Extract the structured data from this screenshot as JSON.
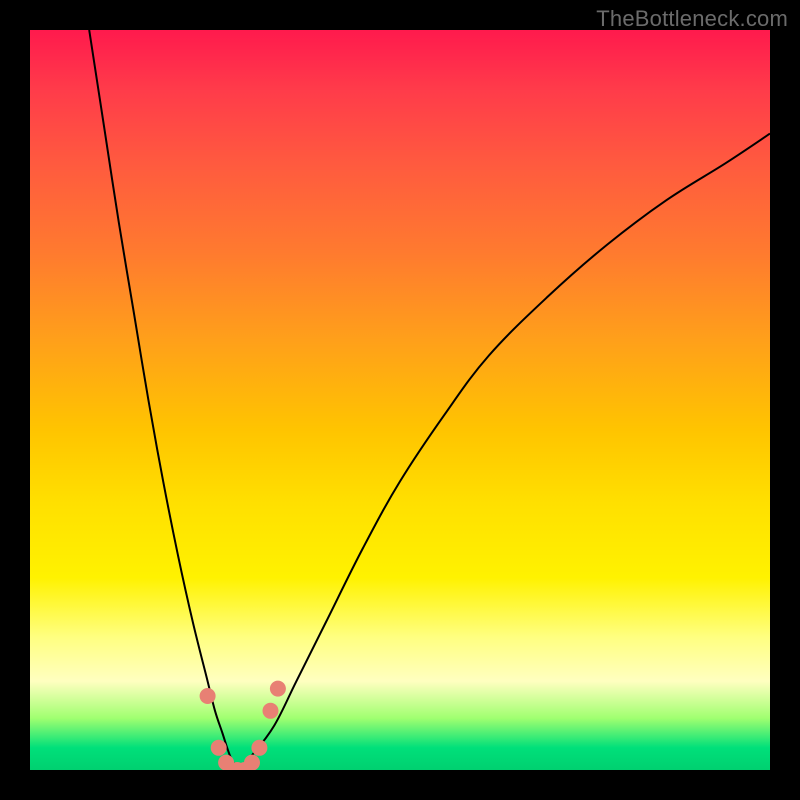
{
  "watermark": "TheBottleneck.com",
  "chart_data": {
    "type": "line",
    "title": "",
    "xlabel": "",
    "ylabel": "",
    "xlim": [
      0,
      100
    ],
    "ylim": [
      0,
      100
    ],
    "background_gradient": {
      "top_color": "#ff1a4d",
      "mid_color": "#ffe000",
      "bottom_color": "#00d070"
    },
    "series": [
      {
        "name": "left-curve",
        "x": [
          8,
          10,
          12,
          14,
          16,
          18,
          20,
          22,
          24,
          25,
          26,
          27,
          28
        ],
        "values": [
          100,
          87,
          74,
          62,
          50,
          39,
          29,
          20,
          12,
          8,
          5,
          2,
          0
        ]
      },
      {
        "name": "right-curve",
        "x": [
          28,
          30,
          33,
          36,
          40,
          45,
          50,
          56,
          62,
          70,
          78,
          86,
          94,
          100
        ],
        "values": [
          0,
          2,
          6,
          12,
          20,
          30,
          39,
          48,
          56,
          64,
          71,
          77,
          82,
          86
        ]
      }
    ],
    "markers": [
      {
        "x": 24.0,
        "y": 10
      },
      {
        "x": 25.5,
        "y": 3
      },
      {
        "x": 26.5,
        "y": 1
      },
      {
        "x": 28.0,
        "y": 0
      },
      {
        "x": 29.0,
        "y": 0
      },
      {
        "x": 30.0,
        "y": 1
      },
      {
        "x": 31.0,
        "y": 3
      },
      {
        "x": 32.5,
        "y": 8
      },
      {
        "x": 33.5,
        "y": 11
      }
    ],
    "marker_color": "#e88074"
  }
}
